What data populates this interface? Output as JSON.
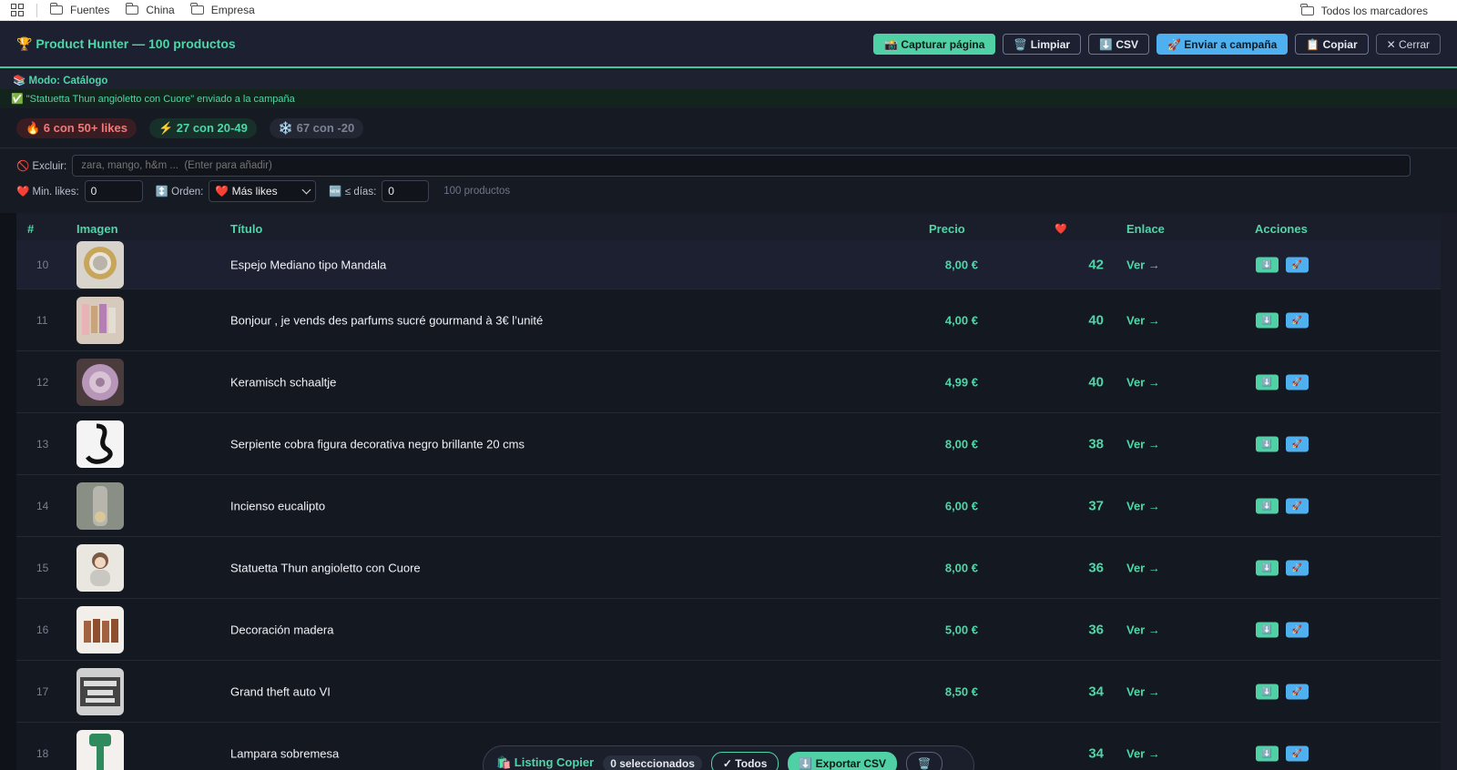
{
  "bookmarks": {
    "items": [
      "Fuentes",
      "China",
      "Empresa"
    ],
    "all_label": "Todos los marcadores"
  },
  "header": {
    "title": "🏆 Product Hunter — 100 productos",
    "buttons": {
      "capture": "📸 Capturar página",
      "clear": "🗑️ Limpiar",
      "csv": "⬇️ CSV",
      "send": "🚀 Enviar a campaña",
      "copy": "📋 Copiar",
      "close": "✕ Cerrar"
    }
  },
  "mode": "📚 Modo: Catálogo",
  "notice": "✅ \"Statuetta Thun angioletto con Cuore\" enviado a la campaña",
  "badges": {
    "hot": "🔥 6 con 50+ likes",
    "mid": "⚡ 27 con 20-49",
    "low": "❄️ 67 con -20"
  },
  "filters": {
    "exclude_label": "🚫 Excluir:",
    "exclude_placeholder": "zara, mango, h&m ...  (Enter para añadir)",
    "min_likes_label": "❤️ Min. likes:",
    "min_likes_value": "0",
    "order_label": "↕️ Orden:",
    "order_value": "❤️ Más likes",
    "days_label": "🆕 ≤ días:",
    "days_value": "0",
    "count_text": "100 productos"
  },
  "table": {
    "columns": [
      "#",
      "Imagen",
      "Título",
      "Precio",
      "❤️",
      "Enlace",
      "Acciones"
    ],
    "link_label": "Ver →",
    "action_download": "⬇️",
    "action_send": "🚀",
    "rows": [
      {
        "num": "10",
        "title": "Espejo Mediano tipo Mandala",
        "price": "8,00 €",
        "likes": "42"
      },
      {
        "num": "11",
        "title": "Bonjour , je vends des parfums sucré gourmand à 3€ l’unité",
        "price": "4,00 €",
        "likes": "40"
      },
      {
        "num": "12",
        "title": "Keramisch schaaltje",
        "price": "4,99 €",
        "likes": "40"
      },
      {
        "num": "13",
        "title": "Serpiente cobra figura decorativa negro brillante 20 cms",
        "price": "8,00 €",
        "likes": "38"
      },
      {
        "num": "14",
        "title": "Incienso eucalipto",
        "price": "6,00 €",
        "likes": "37"
      },
      {
        "num": "15",
        "title": "Statuetta Thun angioletto con Cuore",
        "price": "8,00 €",
        "likes": "36"
      },
      {
        "num": "16",
        "title": "Decoración madera",
        "price": "5,00 €",
        "likes": "36"
      },
      {
        "num": "17",
        "title": "Grand theft auto VI",
        "price": "8,50 €",
        "likes": "34"
      },
      {
        "num": "18",
        "title": "Lampara sobremesa",
        "price": "",
        "likes": "34"
      }
    ]
  },
  "floatbar": {
    "title": "🛍️ Listing Copier",
    "selected": "0 seleccionados",
    "all": "✓ Todos",
    "export": "⬇️ Exportar CSV",
    "trash": "🗑️"
  }
}
